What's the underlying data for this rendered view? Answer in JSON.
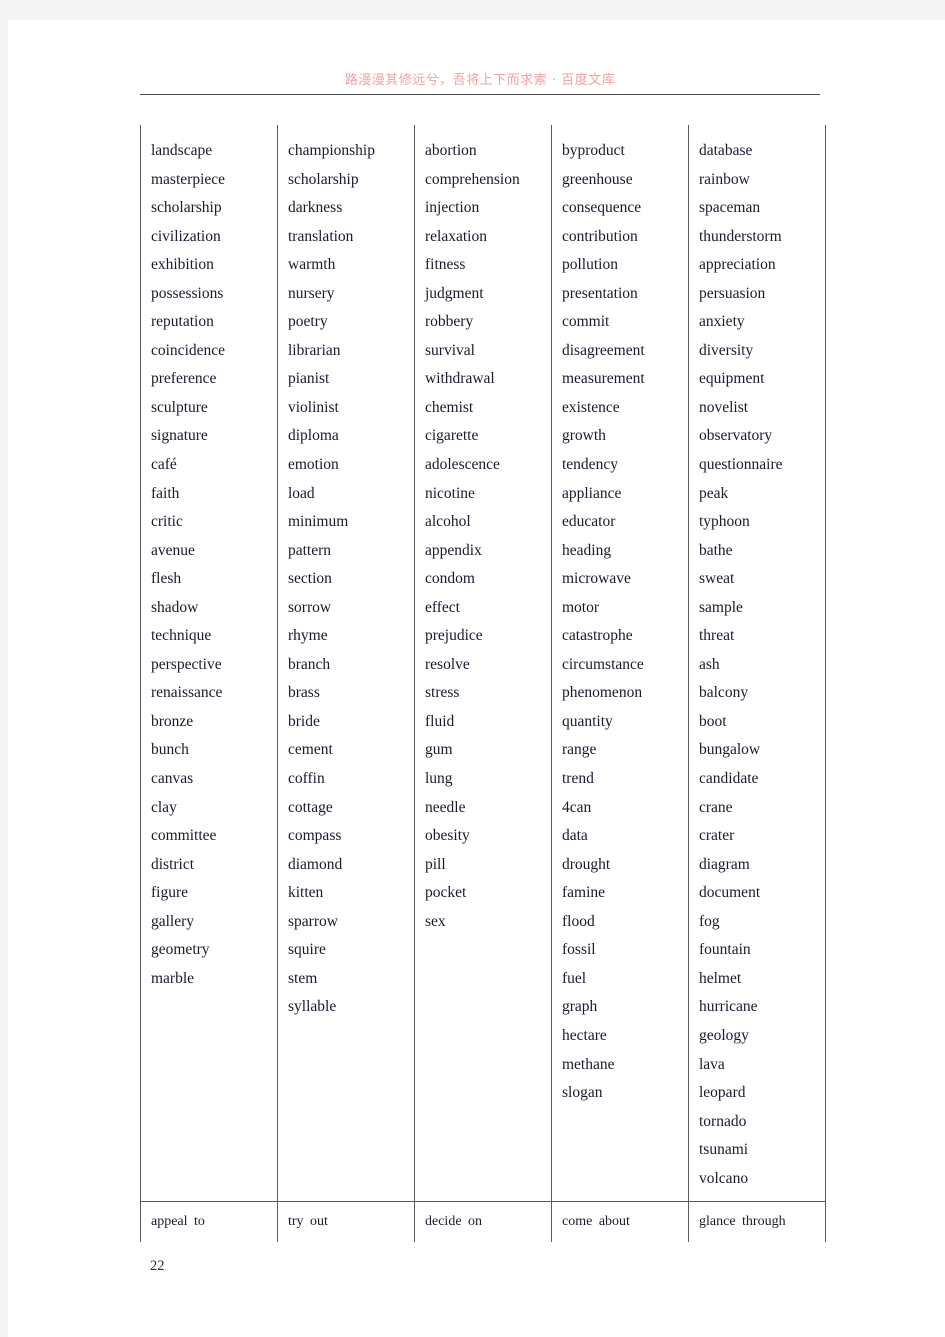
{
  "page": {
    "header_text": "路漫漫其修远兮，吾将上下而求索 · 百度文库",
    "page_number": "22",
    "header_color": "#f2a1a1",
    "rule_color": "#4a4a4a",
    "text_color": "#1a1a2e"
  },
  "word_table": {
    "columns": [
      {
        "index": 1,
        "words": [
          "landscape",
          "masterpiece",
          "scholarship",
          "civilization",
          "exhibition",
          "possessions",
          "reputation",
          "coincidence",
          "preference",
          "sculpture",
          "signature",
          "café",
          "faith",
          "critic",
          "avenue",
          "flesh",
          "shadow",
          "technique",
          "perspective",
          "renaissance",
          "bronze",
          "bunch",
          "canvas",
          "clay",
          "committee",
          "district",
          "figure",
          "gallery",
          "geometry",
          "marble"
        ],
        "phrasal": "appeal to"
      },
      {
        "index": 2,
        "words": [
          "championship",
          "scholarship",
          "darkness",
          "translation",
          "warmth",
          "nursery",
          "poetry",
          "librarian",
          "pianist",
          "violinist",
          "diploma",
          "emotion",
          "load",
          "minimum",
          "pattern",
          "section",
          "sorrow",
          "rhyme",
          "branch",
          "brass",
          "bride",
          "cement",
          "coffin",
          "cottage",
          "compass",
          "diamond",
          "kitten",
          "sparrow",
          "squire",
          "stem",
          "syllable"
        ],
        "phrasal": "try out"
      },
      {
        "index": 3,
        "words": [
          "abortion",
          "comprehension",
          "injection",
          "relaxation",
          "fitness",
          "judgment",
          "robbery",
          "survival",
          "withdrawal",
          "chemist",
          "cigarette",
          "adolescence",
          "nicotine",
          "alcohol",
          "appendix",
          "condom",
          "effect",
          "prejudice",
          "resolve",
          "stress",
          "fluid",
          "gum",
          "lung",
          "needle",
          "obesity",
          "pill",
          "pocket",
          "sex"
        ],
        "phrasal": "decide on"
      },
      {
        "index": 4,
        "words": [
          "byproduct",
          "greenhouse",
          "consequence",
          "contribution",
          "pollution",
          "presentation",
          "commit",
          "disagreement",
          "measurement",
          "existence",
          "growth",
          "tendency",
          "appliance",
          "educator",
          "heading",
          "microwave",
          "motor",
          "catastrophe",
          "circumstance",
          "phenomenon",
          "quantity",
          "range",
          "trend",
          "4can",
          "data",
          "drought",
          "famine",
          "flood",
          "fossil",
          "fuel",
          "graph",
          "hectare",
          "methane",
          "slogan"
        ],
        "phrasal": "come about"
      },
      {
        "index": 5,
        "words": [
          "database",
          "rainbow",
          "spaceman",
          "thunderstorm",
          "appreciation",
          "persuasion",
          "anxiety",
          "diversity",
          "equipment",
          "novelist",
          "observatory",
          "questionnaire",
          "peak",
          "typhoon",
          "bathe",
          "sweat",
          "sample",
          "threat",
          "ash",
          "balcony",
          "boot",
          "bungalow",
          "candidate",
          "crane",
          "crater",
          "diagram",
          "document",
          "fog",
          "fountain",
          "helmet",
          "hurricane",
          "geology",
          "lava",
          "leopard",
          "tornado",
          "tsunami",
          "volcano"
        ],
        "phrasal": "glance through"
      }
    ]
  }
}
